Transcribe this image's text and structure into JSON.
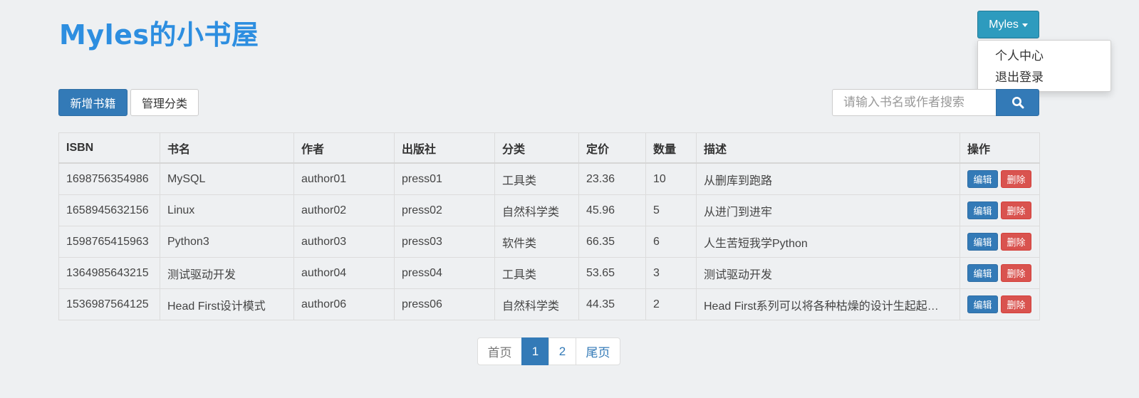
{
  "header": {
    "brand": "Myles的小书屋",
    "user_button": "Myles",
    "user_menu": [
      "个人中心",
      "退出登录"
    ]
  },
  "toolbar": {
    "add_book": "新增书籍",
    "manage_categories": "管理分类",
    "search_placeholder": "请输入书名或作者搜索"
  },
  "table": {
    "columns": [
      "ISBN",
      "书名",
      "作者",
      "出版社",
      "分类",
      "定价",
      "数量",
      "描述",
      "操作"
    ],
    "rows": [
      [
        "1698756354986",
        "MySQL",
        "author01",
        "press01",
        "工具类",
        "23.36",
        "10",
        "从删库到跑路"
      ],
      [
        "1658945632156",
        "Linux",
        "author02",
        "press02",
        "自然科学类",
        "45.96",
        "5",
        "从进门到进牢"
      ],
      [
        "1598765415963",
        "Python3",
        "author03",
        "press03",
        "软件类",
        "66.35",
        "6",
        "人生苦短我学Python"
      ],
      [
        "1364985643215",
        "测试驱动开发",
        "author04",
        "press04",
        "工具类",
        "53.65",
        "3",
        "测试驱动开发"
      ],
      [
        "1536987564125",
        "Head First设计模式",
        "author06",
        "press06",
        "自然科学类",
        "44.35",
        "2",
        "Head First系列可以将各种枯燥的设计生起起…"
      ]
    ],
    "edit_label": "编辑",
    "delete_label": "删除"
  },
  "pagination": {
    "first": "首页",
    "pages": [
      "1",
      "2"
    ],
    "current": "1",
    "last": "尾页"
  },
  "colors": {
    "brand": "#2d8ee0",
    "primary": "#337ab7",
    "danger": "#d9534f",
    "user_button": "#2e9bbe"
  }
}
